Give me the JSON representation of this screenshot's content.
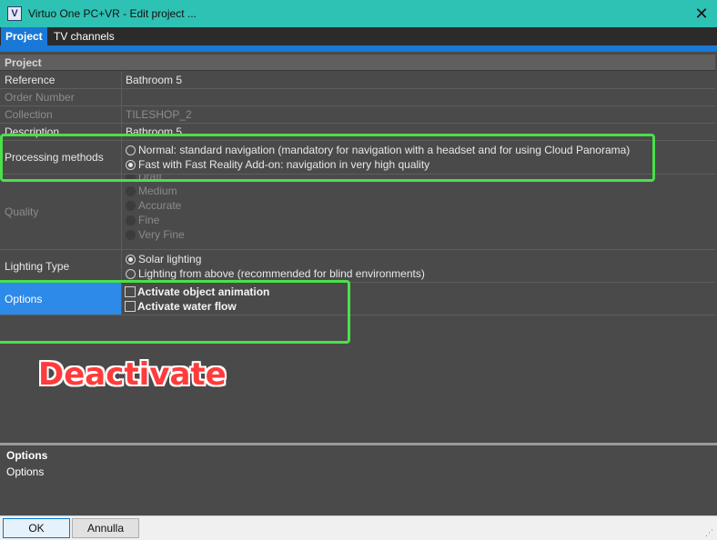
{
  "window": {
    "app_icon_letter": "V",
    "title": "Virtuo One PC+VR - Edit project ...",
    "close_glyph": "✕"
  },
  "tabs": [
    {
      "label": "Project",
      "active": true
    },
    {
      "label": "TV channels",
      "active": false
    }
  ],
  "section": {
    "title": "Project"
  },
  "rows": {
    "reference": {
      "label": "Reference",
      "value": "Bathroom 5"
    },
    "order_number": {
      "label": "Order Number",
      "value": ""
    },
    "collection": {
      "label": "Collection",
      "value": "TILESHOP_2"
    },
    "description": {
      "label": "Description",
      "value": "Bathroom 5"
    },
    "processing_methods": {
      "label": "Processing methods",
      "options": [
        {
          "label": "Normal: standard navigation (mandatory for navigation with a headset and for using Cloud Panorama)",
          "selected": false
        },
        {
          "label": "Fast with Fast Reality Add-on: navigation in very high quality",
          "selected": true
        }
      ]
    },
    "quality": {
      "label": "Quality",
      "options": [
        "Draft",
        "Medium",
        "Accurate",
        "Fine",
        "Very Fine"
      ]
    },
    "lighting_type": {
      "label": "Lighting Type",
      "options": [
        {
          "label": "Solar lighting",
          "selected": true
        },
        {
          "label": "Lighting from above (recommended for blind environments)",
          "selected": false
        }
      ]
    },
    "options": {
      "label": "Options",
      "checkboxes": [
        {
          "label": "Activate object animation",
          "checked": false
        },
        {
          "label": "Activate water flow",
          "checked": false
        }
      ]
    }
  },
  "annotation": {
    "text": "Deactivate",
    "color": "#ff3b3b",
    "highlight_color": "#49e04a"
  },
  "help": {
    "title": "Options",
    "text": "Options"
  },
  "buttons": {
    "ok": "OK",
    "cancel": "Annulla"
  },
  "colors": {
    "titlebar": "#2ec2b4",
    "accent": "#1a78d6",
    "selected_row": "#2d8ae8"
  }
}
